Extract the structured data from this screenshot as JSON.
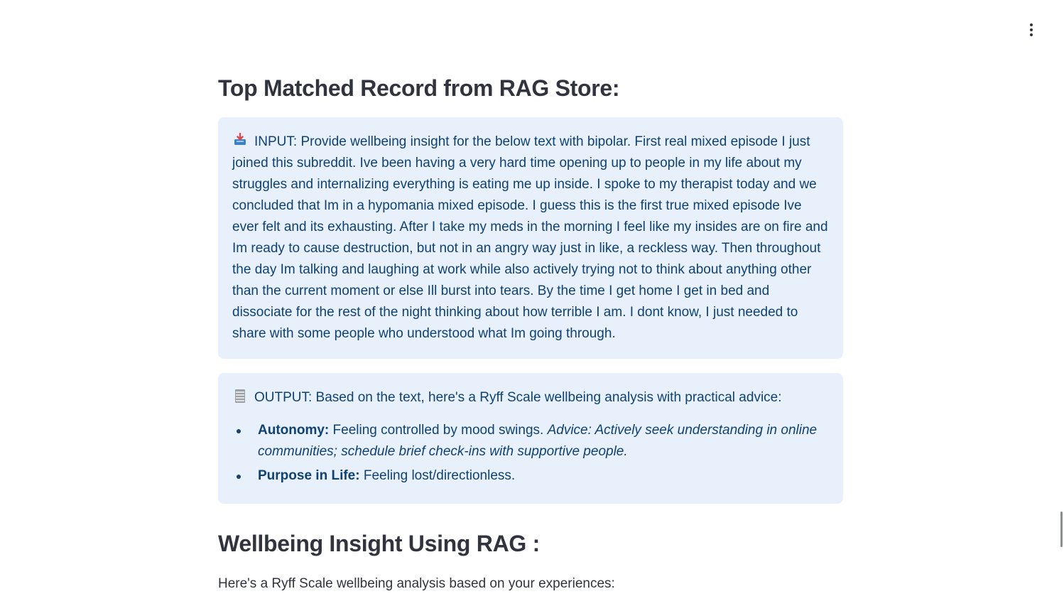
{
  "header": {
    "menu_icon": "vertical-ellipsis-icon"
  },
  "top_matched": {
    "heading": "Top Matched Record from RAG Store:",
    "input_icon": "inbox-tray-icon",
    "input_text": "INPUT: Provide wellbeing insight for the below text with bipolar. First real mixed episode I just joined this subreddit. Ive been having a very hard time opening up to people in my life about my struggles and internalizing everything is eating me up inside. I spoke to my therapist today and we concluded that Im in a hypomania mixed episode. I guess this is the first true mixed episode Ive ever felt and its exhausting. After I take my meds in the morning I feel like my insides are on fire and Im ready to cause destruction, but not in an angry way just in like, a reckless way. Then throughout the day Im talking and laughing at work while also actively trying not to think about anything other than the current moment or else Ill burst into tears. By the time I get home I get in bed and dissociate for the rest of the night thinking about how terrible I am. I dont know, I just needed to share with some people who understood what Im going through.",
    "output_icon": "receipt-icon",
    "output_text": "OUTPUT: Based on the text, here's a Ryff Scale wellbeing analysis with practical advice:",
    "items": [
      {
        "label": "Autonomy:",
        "text": " Feeling controlled by mood swings. ",
        "advice": "Advice: Actively seek understanding in online communities; schedule brief check-ins with supportive people."
      },
      {
        "label": "Purpose in Life:",
        "text": " Feeling lost/directionless.",
        "advice": ""
      }
    ]
  },
  "insight": {
    "heading": "Wellbeing Insight Using RAG :",
    "intro": "Here's a Ryff Scale wellbeing analysis based on your experiences:"
  },
  "colors": {
    "info_bg": "#e8f1fb",
    "info_text": "#0f4172",
    "body_text": "#31333f"
  }
}
